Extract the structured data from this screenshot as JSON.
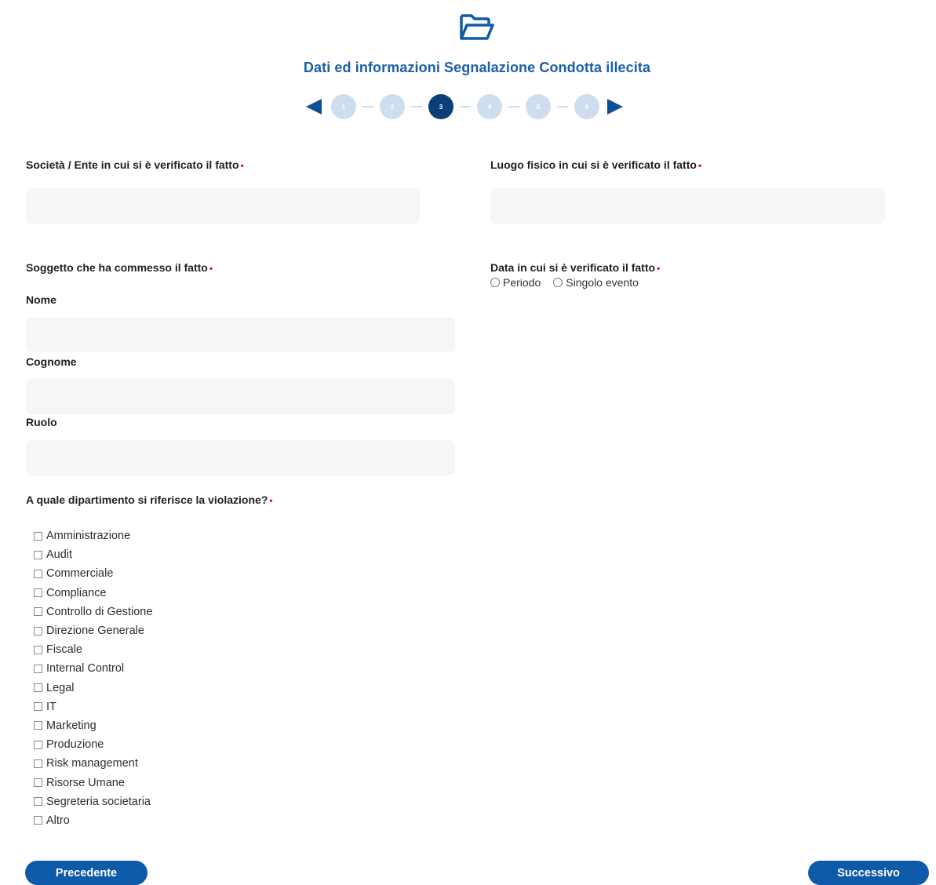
{
  "header": {
    "icon": "folder-open-icon",
    "title": "Dati ed informazioni Segnalazione Condotta illecita",
    "steps": [
      "1",
      "2",
      "3",
      "4",
      "5",
      "6"
    ],
    "active_step": 3
  },
  "form": {
    "company": {
      "label": "Società / Ente in cui si è verificato il fatto",
      "required_mark": "•",
      "value": ""
    },
    "location": {
      "label": "Luogo fisico in cui si è verificato il fatto",
      "required_mark": "•",
      "value": ""
    },
    "subject": {
      "label": "Soggetto che ha commesso il fatto",
      "required_mark": "•",
      "nome_label": "Nome",
      "cognome_label": "Cognome",
      "ruolo_label": "Ruolo"
    },
    "date": {
      "label": "Data in cui si è verificato il fatto",
      "required_mark": "•",
      "options": [
        "Periodo",
        "Singolo evento"
      ]
    },
    "department": {
      "label": "A quale dipartimento si riferisce la violazione?",
      "required_mark": "•",
      "options": [
        "Amministrazione",
        "Audit",
        "Commerciale",
        "Compliance",
        "Controllo di Gestione",
        "Direzione Generale",
        "Fiscale",
        "Internal Control",
        "Legal",
        "IT",
        "Marketing",
        "Produzione",
        "Risk management",
        "Risorse Umane",
        "Segreteria societaria",
        "Altro"
      ]
    }
  },
  "nav": {
    "prev_label": "Precedente",
    "next_label": "Successivo"
  },
  "colors": {
    "accent": "#0d5aa9",
    "title": "#1b5fa6",
    "step_inactive": "#cfdeee",
    "step_active": "#0a3f78",
    "required": "#d61a1a"
  }
}
